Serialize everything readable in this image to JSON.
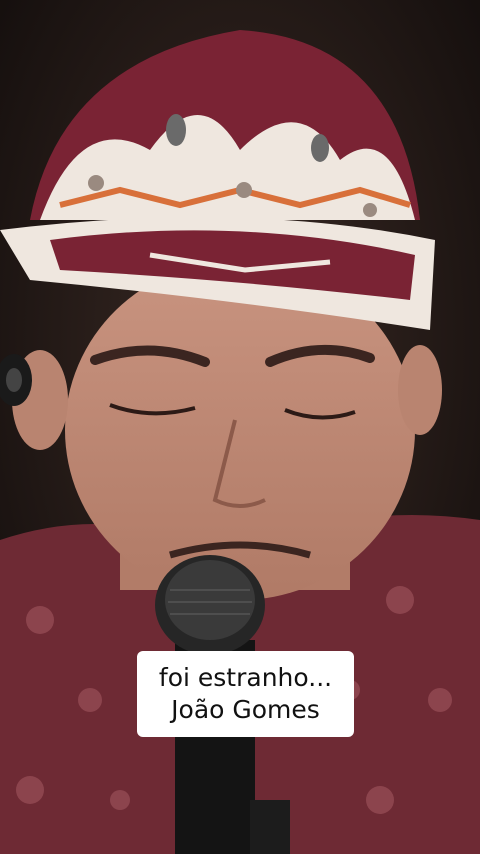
{
  "caption": {
    "line1": "foi estranho...",
    "line2": "João Gomes"
  },
  "colors": {
    "background": "#1a1412",
    "hat": "#7a2334",
    "shirt": "#6e2a34",
    "skin": "#c48e78",
    "caption_bg": "#ffffff"
  }
}
